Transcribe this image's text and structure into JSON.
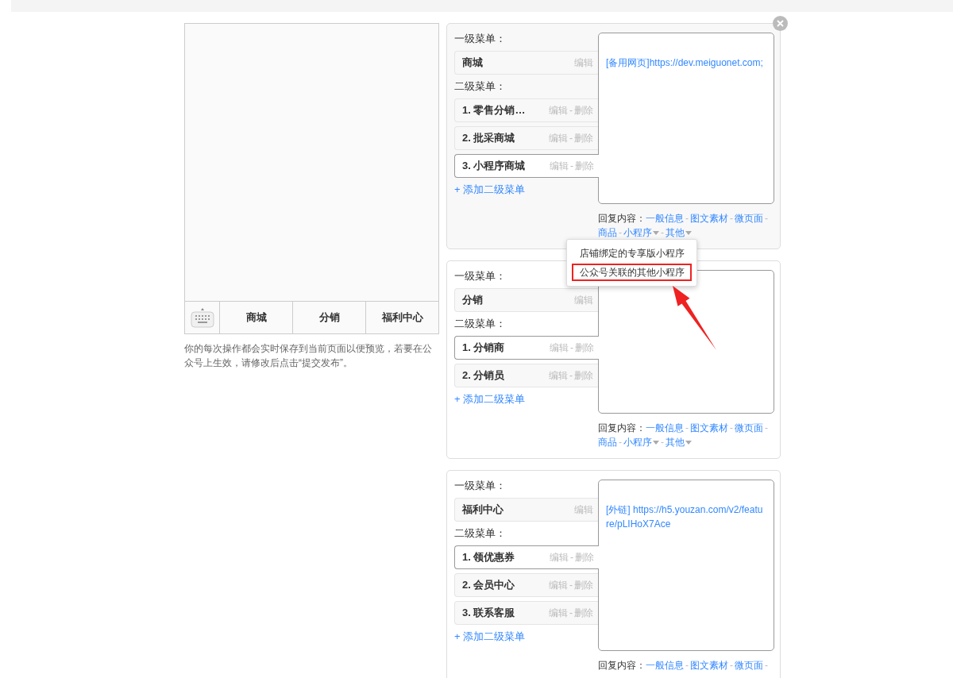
{
  "preview": {
    "tabs": [
      {
        "label": "商城"
      },
      {
        "label": "分销"
      },
      {
        "label": "福利中心"
      }
    ],
    "note": "你的每次操作都会实时保存到当前页面以便预览，若要在公众号上生效，请修改后点击“提交发布”。"
  },
  "cards": [
    {
      "active": true,
      "closable": true,
      "main_label": "一级菜单：",
      "main": {
        "label": "商城",
        "actions": [
          "编辑"
        ]
      },
      "sub_label": "二级菜单：",
      "subs": [
        {
          "label": "1. 零售分销…",
          "actions": [
            "编辑",
            "-",
            "删除"
          ],
          "selected": false
        },
        {
          "label": "2. 批采商城",
          "actions": [
            "编辑",
            "-",
            "删除"
          ],
          "selected": false
        },
        {
          "label": "3. 小程序商城",
          "actions": [
            "编辑",
            "-",
            "删除"
          ],
          "selected": true
        }
      ],
      "add": "+ 添加二级菜单",
      "reply": "[备用网页]https://dev.meiguonet.com;",
      "reply_label": "回复内容：",
      "options": [
        {
          "kind": "link",
          "label": "一般信息"
        },
        {
          "kind": "separator",
          "label": "-"
        },
        {
          "kind": "link",
          "label": "图文素材"
        },
        {
          "kind": "separator",
          "label": "-"
        },
        {
          "kind": "link",
          "label": "微页面"
        },
        {
          "kind": "separator",
          "label": "-"
        },
        {
          "kind": "link",
          "label": "商品"
        },
        {
          "kind": "separator",
          "label": "-"
        },
        {
          "kind": "link",
          "label": "小程序",
          "dropdown": true
        },
        {
          "kind": "separator",
          "label": "-"
        },
        {
          "kind": "link",
          "label": "其他",
          "dropdown": true
        }
      ],
      "dropdown": {
        "items": [
          {
            "label": "店铺绑定的专享版小程序",
            "highlighted": false
          },
          {
            "label": "公众号关联的其他小程序",
            "highlighted": true
          }
        ]
      }
    },
    {
      "active": false,
      "closable": false,
      "main_label": "一级菜单：",
      "main": {
        "label": "分销",
        "actions": [
          "编辑"
        ]
      },
      "sub_label": "二级菜单：",
      "subs": [
        {
          "label": "1. 分销商",
          "actions": [
            "编辑",
            "-",
            "删除"
          ],
          "selected": true
        },
        {
          "label": "2. 分销员",
          "actions": [
            "编辑",
            "-",
            "删除"
          ],
          "selected": false
        }
      ],
      "add": "+ 添加二级菜单",
      "reply_label": "回复内容：",
      "options": [
        {
          "kind": "link",
          "label": "一般信息"
        },
        {
          "kind": "separator",
          "label": "-"
        },
        {
          "kind": "link",
          "label": "图文素材"
        },
        {
          "kind": "separator",
          "label": "-"
        },
        {
          "kind": "link",
          "label": "微页面"
        },
        {
          "kind": "separator",
          "label": "-"
        },
        {
          "kind": "link",
          "label": "商品"
        },
        {
          "kind": "separator",
          "label": "-"
        },
        {
          "kind": "link",
          "label": "小程序",
          "dropdown": true
        },
        {
          "kind": "separator",
          "label": "-"
        },
        {
          "kind": "link",
          "label": "其他",
          "dropdown": true
        }
      ]
    },
    {
      "active": false,
      "closable": false,
      "main_label": "一级菜单：",
      "main": {
        "label": "福利中心",
        "actions": [
          "编辑"
        ]
      },
      "sub_label": "二级菜单：",
      "subs": [
        {
          "label": "1. 领优惠券",
          "actions": [
            "编辑",
            "-",
            "删除"
          ],
          "selected": true
        },
        {
          "label": "2. 会员中心",
          "actions": [
            "编辑",
            "-",
            "删除"
          ],
          "selected": false
        },
        {
          "label": "3. 联系客服",
          "actions": [
            "编辑",
            "-",
            "删除"
          ],
          "selected": false
        }
      ],
      "add": "+ 添加二级菜单",
      "reply": "[外链] https://h5.youzan.com/v2/feature/pLIHoX7Ace",
      "reply_label": "回复内容：",
      "options": [
        {
          "kind": "link",
          "label": "一般信息"
        },
        {
          "kind": "separator",
          "label": "-"
        },
        {
          "kind": "link",
          "label": "图文素材"
        },
        {
          "kind": "separator",
          "label": "-"
        },
        {
          "kind": "link",
          "label": "微页面"
        },
        {
          "kind": "separator",
          "label": "-"
        }
      ]
    }
  ],
  "annotation": {
    "kind": "arrow"
  }
}
